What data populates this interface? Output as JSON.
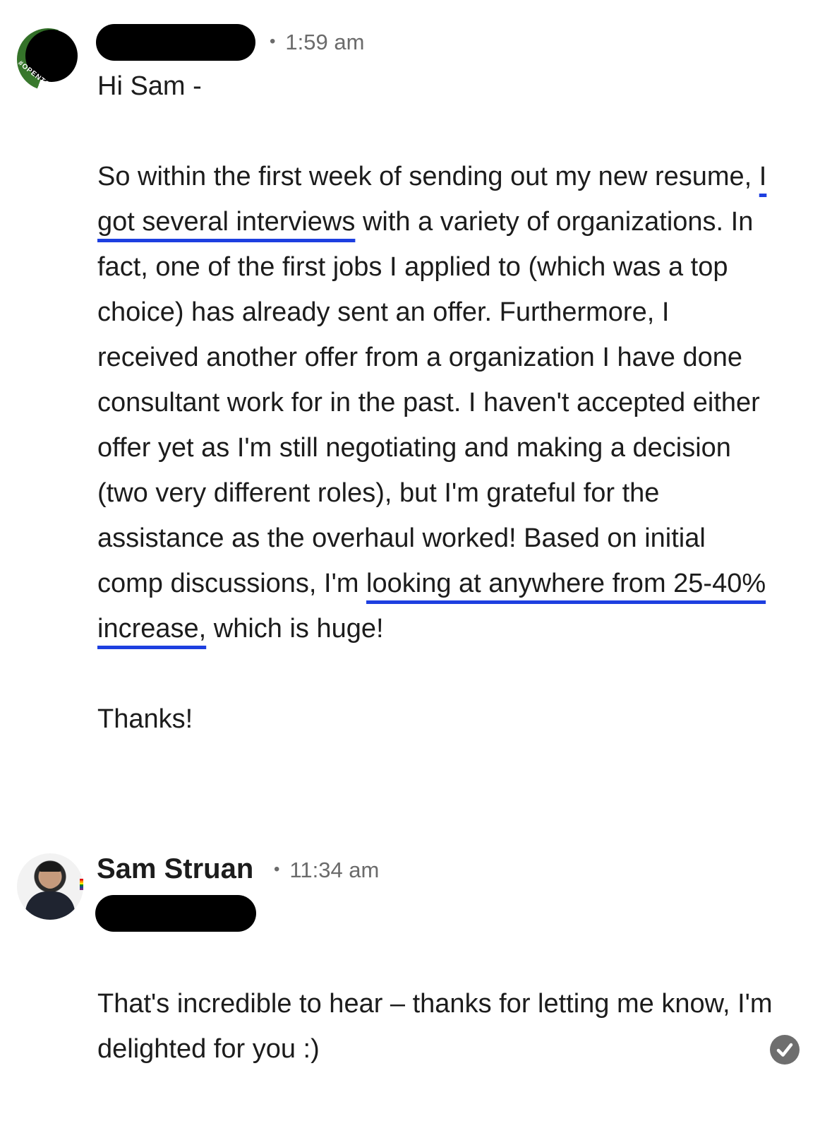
{
  "messages": [
    {
      "sender_name_redacted": true,
      "avatar_badge": "#OPENTOWORK",
      "time": "1:59 am",
      "paragraphs": [
        {
          "segments": [
            {
              "text": "Hi Sam -"
            }
          ]
        },
        {
          "segments": [
            {
              "text": "So within the first week of sending out my new resume, "
            },
            {
              "text": "I got several interviews",
              "highlight": true
            },
            {
              "text": " with a variety of organizations. In fact, one of the first jobs I applied to (which was a top choice) has already sent an offer. Furthermore, I received another offer from a organization I have done consultant work for in the past. I haven't accepted either offer yet as I'm still negotiating and making a decision (two very different roles), but I'm grateful for the assistance as the overhaul worked! Based on initial comp discussions, I'm "
            },
            {
              "text": "looking at anywhere from 25-40% increase,",
              "highlight": true
            },
            {
              "text": " which is huge!"
            }
          ]
        },
        {
          "segments": [
            {
              "text": "Thanks!"
            }
          ]
        }
      ]
    },
    {
      "sender_name": "Sam Struan",
      "time": "11:34 am",
      "recipient_redacted": true,
      "paragraphs": [
        {
          "segments": [
            {
              "text": "That's incredible to hear – thanks for letting me know, I'm delighted for you :)"
            }
          ]
        }
      ],
      "read_receipt_icon": "checkmark-circle-icon"
    }
  ],
  "colors": {
    "highlight_underline": "#1d3fe0",
    "open_to_work_green": "#3a7a2e",
    "timestamp_gray": "#6b6b6b"
  }
}
